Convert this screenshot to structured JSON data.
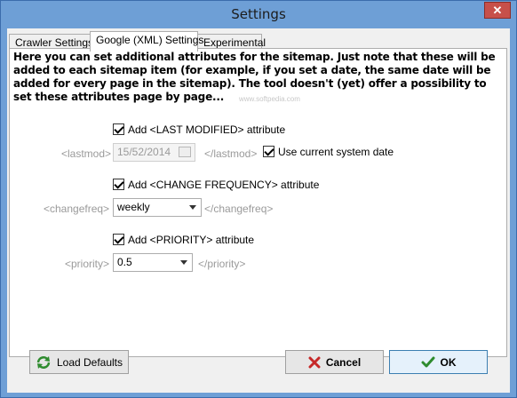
{
  "window": {
    "title": "Settings",
    "close_glyph": "✕"
  },
  "tabs": [
    {
      "label": "Crawler Settings"
    },
    {
      "label": "Google (XML) Settings"
    },
    {
      "label": "Experimental"
    }
  ],
  "panel": {
    "intro": "Here you  can set additional attributes for the sitemap. Just note that these will be added to each sitemap item (for example, if you set a date, the same date will be added for every page in the sitemap). The tool doesn't (yet) offer a possibility to set these attributes page by page...",
    "watermark": "www.softpedia.com",
    "lastmod": {
      "checkbox_label": "Add <LAST MODIFIED> attribute",
      "open_tag": "<lastmod>",
      "date_value": "15/52/2014",
      "close_tag": "</lastmod>",
      "use_current_label": "Use current system date"
    },
    "changefreq": {
      "checkbox_label": "Add <CHANGE FREQUENCY> attribute",
      "open_tag": "<changefreq>",
      "selected": "weekly",
      "close_tag": "</changefreq>"
    },
    "priority": {
      "checkbox_label": "Add <PRIORITY> attribute",
      "open_tag": "<priority>",
      "selected": "0.5",
      "close_tag": "</priority>"
    }
  },
  "buttons": {
    "load_defaults": "Load Defaults",
    "cancel": "Cancel",
    "ok": "OK"
  },
  "icons": {
    "refresh": "refresh-icon",
    "cancel": "red-x-icon",
    "ok": "green-check-icon"
  }
}
